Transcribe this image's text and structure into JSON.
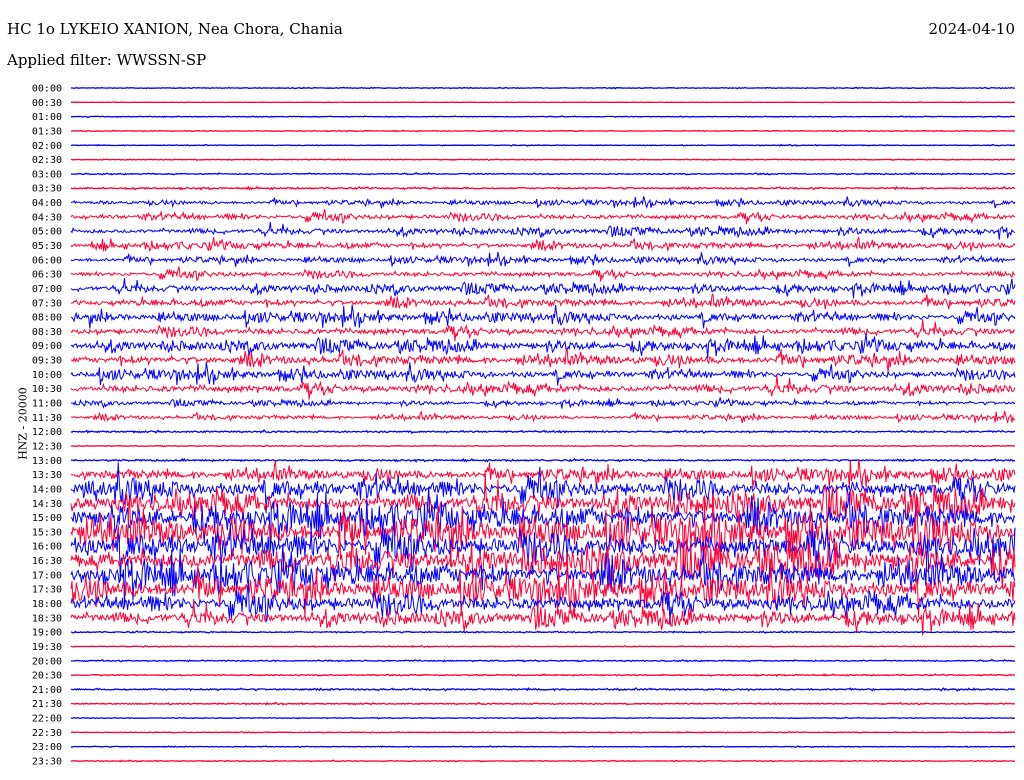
{
  "header": {
    "station": "HC 1o LYKEIO XANION, Nea Chora, Chania",
    "filter": "Applied filter: WWSSN-SP",
    "date": "2024-04-10"
  },
  "chart_data": {
    "type": "line",
    "title": "HC 1o LYKEIO XANION, Nea Chora, Chania",
    "ylabel": "HNZ - 20000",
    "xlabel": "",
    "colors": [
      "#0000ff",
      "#ff0033"
    ],
    "rows": [
      "00:00",
      "00:30",
      "01:00",
      "01:30",
      "02:00",
      "02:30",
      "03:00",
      "03:30",
      "04:00",
      "04:30",
      "05:00",
      "05:30",
      "06:00",
      "06:30",
      "07:00",
      "07:30",
      "08:00",
      "08:30",
      "09:00",
      "09:30",
      "10:00",
      "10:30",
      "11:00",
      "11:30",
      "12:00",
      "12:30",
      "13:00",
      "13:30",
      "14:00",
      "14:30",
      "15:00",
      "15:30",
      "16:00",
      "16:30",
      "17:00",
      "17:30",
      "18:00",
      "18:30",
      "19:00",
      "19:30",
      "20:00",
      "20:30",
      "21:00",
      "21:30",
      "22:00",
      "22:30",
      "23:00",
      "23:30"
    ],
    "relative_amplitude": [
      1,
      0.5,
      1,
      1,
      1,
      1,
      1.5,
      2,
      8,
      12,
      12,
      12,
      10,
      12,
      14,
      14,
      16,
      16,
      18,
      18,
      16,
      18,
      8,
      8,
      2,
      1,
      2,
      20,
      35,
      40,
      45,
      50,
      50,
      50,
      45,
      40,
      35,
      25,
      1.5,
      1,
      1.5,
      1.5,
      2,
      1.5,
      1,
      1,
      1,
      1
    ]
  }
}
